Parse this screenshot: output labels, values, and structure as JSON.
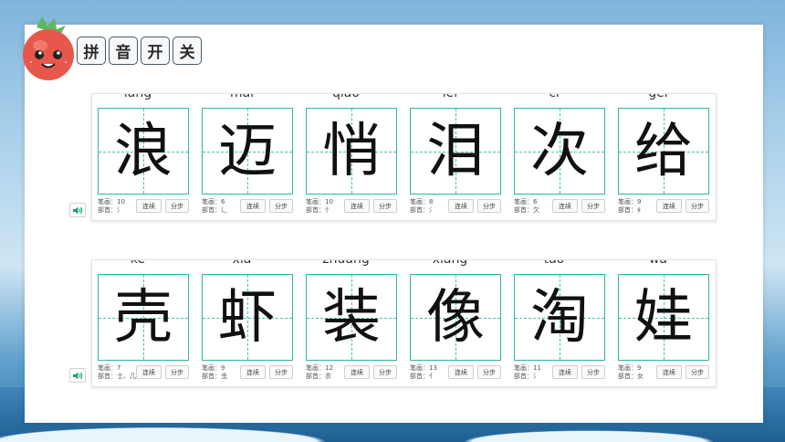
{
  "toolbar": {
    "buttons": [
      "拼",
      "音",
      "开",
      "关"
    ]
  },
  "rows": [
    {
      "chars": [
        {
          "pinyin": "làng",
          "hanzi": "浪",
          "strokes": "笔画：10",
          "radical": "部首：氵"
        },
        {
          "pinyin": "mài",
          "hanzi": "迈",
          "strokes": "笔画：6",
          "radical": "部首：辶"
        },
        {
          "pinyin": "qiāo",
          "hanzi": "悄",
          "strokes": "笔画：10",
          "radical": "部首：忄"
        },
        {
          "pinyin": "lèi",
          "hanzi": "泪",
          "strokes": "笔画：8",
          "radical": "部首：氵"
        },
        {
          "pinyin": "cì",
          "hanzi": "次",
          "strokes": "笔画：6",
          "radical": "部首：欠"
        },
        {
          "pinyin": "gěi",
          "hanzi": "给",
          "strokes": "笔画：9",
          "radical": "部首：纟"
        }
      ]
    },
    {
      "chars": [
        {
          "pinyin": "ké",
          "hanzi": "壳",
          "strokes": "笔画：7",
          "radical": "部首：士、几"
        },
        {
          "pinyin": "xiā",
          "hanzi": "虾",
          "strokes": "笔画：9",
          "radical": "部首：虫"
        },
        {
          "pinyin": "zhuāng",
          "hanzi": "装",
          "strokes": "笔画：12",
          "radical": "部首：衣"
        },
        {
          "pinyin": "xiàng",
          "hanzi": "像",
          "strokes": "笔画：13",
          "radical": "部首：亻"
        },
        {
          "pinyin": "táo",
          "hanzi": "淘",
          "strokes": "笔画：11",
          "radical": "部首：氵"
        },
        {
          "pinyin": "wá",
          "hanzi": "娃",
          "strokes": "笔画：9",
          "radical": "部首：女"
        }
      ]
    }
  ],
  "labels": {
    "continuous": "连续",
    "stepwise": "分步"
  },
  "icons": {
    "speaker": "speaker-icon",
    "mascot": "strawberry-mascot-icon"
  },
  "colors": {
    "grid": "#2bb8a3",
    "speaker": "#1aa36f"
  }
}
